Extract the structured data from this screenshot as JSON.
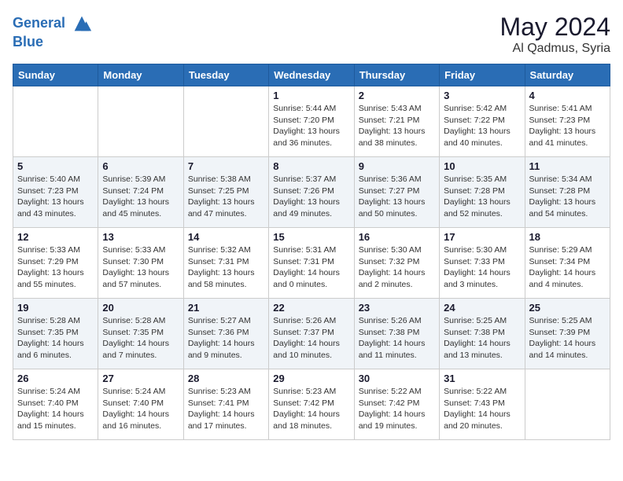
{
  "header": {
    "logo_line1": "General",
    "logo_line2": "Blue",
    "month": "May 2024",
    "location": "Al Qadmus, Syria"
  },
  "days_of_week": [
    "Sunday",
    "Monday",
    "Tuesday",
    "Wednesday",
    "Thursday",
    "Friday",
    "Saturday"
  ],
  "weeks": [
    [
      {
        "day": "",
        "info": ""
      },
      {
        "day": "",
        "info": ""
      },
      {
        "day": "",
        "info": ""
      },
      {
        "day": "1",
        "info": "Sunrise: 5:44 AM\nSunset: 7:20 PM\nDaylight: 13 hours\nand 36 minutes."
      },
      {
        "day": "2",
        "info": "Sunrise: 5:43 AM\nSunset: 7:21 PM\nDaylight: 13 hours\nand 38 minutes."
      },
      {
        "day": "3",
        "info": "Sunrise: 5:42 AM\nSunset: 7:22 PM\nDaylight: 13 hours\nand 40 minutes."
      },
      {
        "day": "4",
        "info": "Sunrise: 5:41 AM\nSunset: 7:23 PM\nDaylight: 13 hours\nand 41 minutes."
      }
    ],
    [
      {
        "day": "5",
        "info": "Sunrise: 5:40 AM\nSunset: 7:23 PM\nDaylight: 13 hours\nand 43 minutes."
      },
      {
        "day": "6",
        "info": "Sunrise: 5:39 AM\nSunset: 7:24 PM\nDaylight: 13 hours\nand 45 minutes."
      },
      {
        "day": "7",
        "info": "Sunrise: 5:38 AM\nSunset: 7:25 PM\nDaylight: 13 hours\nand 47 minutes."
      },
      {
        "day": "8",
        "info": "Sunrise: 5:37 AM\nSunset: 7:26 PM\nDaylight: 13 hours\nand 49 minutes."
      },
      {
        "day": "9",
        "info": "Sunrise: 5:36 AM\nSunset: 7:27 PM\nDaylight: 13 hours\nand 50 minutes."
      },
      {
        "day": "10",
        "info": "Sunrise: 5:35 AM\nSunset: 7:28 PM\nDaylight: 13 hours\nand 52 minutes."
      },
      {
        "day": "11",
        "info": "Sunrise: 5:34 AM\nSunset: 7:28 PM\nDaylight: 13 hours\nand 54 minutes."
      }
    ],
    [
      {
        "day": "12",
        "info": "Sunrise: 5:33 AM\nSunset: 7:29 PM\nDaylight: 13 hours\nand 55 minutes."
      },
      {
        "day": "13",
        "info": "Sunrise: 5:33 AM\nSunset: 7:30 PM\nDaylight: 13 hours\nand 57 minutes."
      },
      {
        "day": "14",
        "info": "Sunrise: 5:32 AM\nSunset: 7:31 PM\nDaylight: 13 hours\nand 58 minutes."
      },
      {
        "day": "15",
        "info": "Sunrise: 5:31 AM\nSunset: 7:31 PM\nDaylight: 14 hours\nand 0 minutes."
      },
      {
        "day": "16",
        "info": "Sunrise: 5:30 AM\nSunset: 7:32 PM\nDaylight: 14 hours\nand 2 minutes."
      },
      {
        "day": "17",
        "info": "Sunrise: 5:30 AM\nSunset: 7:33 PM\nDaylight: 14 hours\nand 3 minutes."
      },
      {
        "day": "18",
        "info": "Sunrise: 5:29 AM\nSunset: 7:34 PM\nDaylight: 14 hours\nand 4 minutes."
      }
    ],
    [
      {
        "day": "19",
        "info": "Sunrise: 5:28 AM\nSunset: 7:35 PM\nDaylight: 14 hours\nand 6 minutes."
      },
      {
        "day": "20",
        "info": "Sunrise: 5:28 AM\nSunset: 7:35 PM\nDaylight: 14 hours\nand 7 minutes."
      },
      {
        "day": "21",
        "info": "Sunrise: 5:27 AM\nSunset: 7:36 PM\nDaylight: 14 hours\nand 9 minutes."
      },
      {
        "day": "22",
        "info": "Sunrise: 5:26 AM\nSunset: 7:37 PM\nDaylight: 14 hours\nand 10 minutes."
      },
      {
        "day": "23",
        "info": "Sunrise: 5:26 AM\nSunset: 7:38 PM\nDaylight: 14 hours\nand 11 minutes."
      },
      {
        "day": "24",
        "info": "Sunrise: 5:25 AM\nSunset: 7:38 PM\nDaylight: 14 hours\nand 13 minutes."
      },
      {
        "day": "25",
        "info": "Sunrise: 5:25 AM\nSunset: 7:39 PM\nDaylight: 14 hours\nand 14 minutes."
      }
    ],
    [
      {
        "day": "26",
        "info": "Sunrise: 5:24 AM\nSunset: 7:40 PM\nDaylight: 14 hours\nand 15 minutes."
      },
      {
        "day": "27",
        "info": "Sunrise: 5:24 AM\nSunset: 7:40 PM\nDaylight: 14 hours\nand 16 minutes."
      },
      {
        "day": "28",
        "info": "Sunrise: 5:23 AM\nSunset: 7:41 PM\nDaylight: 14 hours\nand 17 minutes."
      },
      {
        "day": "29",
        "info": "Sunrise: 5:23 AM\nSunset: 7:42 PM\nDaylight: 14 hours\nand 18 minutes."
      },
      {
        "day": "30",
        "info": "Sunrise: 5:22 AM\nSunset: 7:42 PM\nDaylight: 14 hours\nand 19 minutes."
      },
      {
        "day": "31",
        "info": "Sunrise: 5:22 AM\nSunset: 7:43 PM\nDaylight: 14 hours\nand 20 minutes."
      },
      {
        "day": "",
        "info": ""
      }
    ]
  ]
}
